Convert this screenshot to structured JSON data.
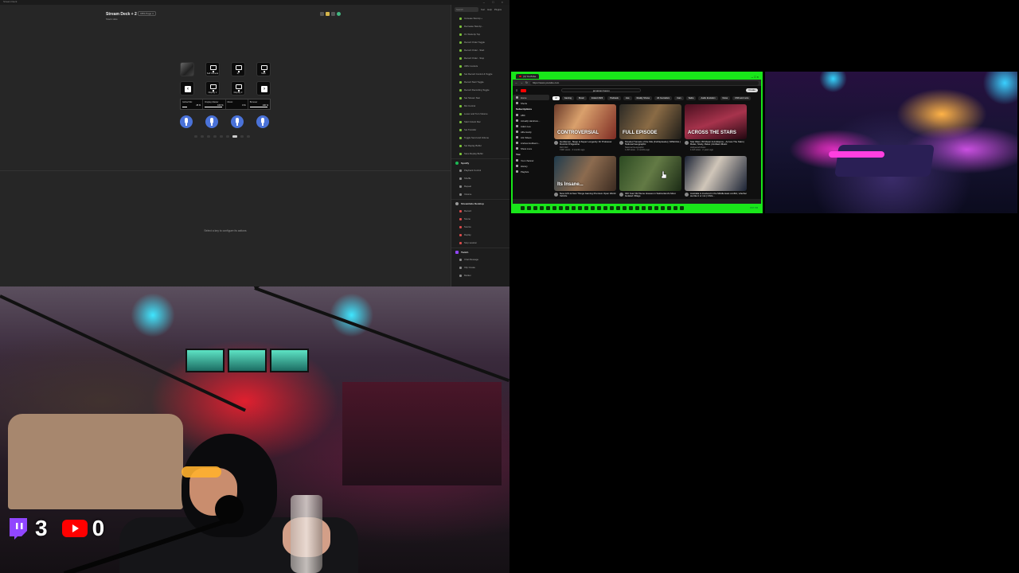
{
  "streamdeck": {
    "app_title": "Stream Deck",
    "window_buttons": "– □ ×",
    "device_name": "Stream Deck + 2",
    "profile_badge": "OBS Page 4",
    "device_sub": "Stack slate",
    "keys": [
      {
        "label": "",
        "kind": "image"
      },
      {
        "label": "Self Camera",
        "kind": "monitor"
      },
      {
        "label": "2x",
        "kind": "monitor"
      },
      {
        "label": "Main",
        "kind": "monitor"
      },
      {
        "label": "",
        "kind": "text",
        "glyph": "‹"
      },
      {
        "label": "Display 2",
        "kind": "monitor"
      },
      {
        "label": "Display 3",
        "kind": "monitor"
      },
      {
        "label": "",
        "kind": "text",
        "glyph": "›"
      }
    ],
    "dials": [
      {
        "label": "Global Mic",
        "value": "25 %",
        "fill": 0.25
      },
      {
        "label": "Display Master",
        "value": "100 %",
        "fill": 1.0
      },
      {
        "label": "Music",
        "value": "0 %",
        "fill": 0.0
      },
      {
        "label": "Browser",
        "value": "100 %",
        "fill": 1.0
      }
    ],
    "pager": {
      "pages": 9,
      "active": 7
    },
    "empty_message": "Select a key to configure its actions",
    "sidebar": {
      "search_placeholder": "Search",
      "tools": [
        "Sort",
        "Help",
        "Plugins"
      ],
      "plugins_a": [
        "Increase Stat Ap +",
        "Decrease Stat Ap -",
        "On Stats Ap Top",
        "Record Order Toggle",
        "Record Order - Start",
        "Record Order - Stop",
        "OBS Controls",
        "Set Record Control & Toggle",
        "Record Start Toggle",
        "Record Recording Toggle",
        "Set Stream Stat",
        "Mic Control",
        "Lower and Turn Volume",
        "Start Instant Rec",
        "Set Transfer",
        "Toggle Send and Volume",
        "Set Replay Buffer",
        "Save Replay Buffer"
      ],
      "group_spotify": "Spotify",
      "plugins_b": [
        "Playback Control",
        "Shuffle",
        "Repeat",
        "Volume"
      ],
      "group_streamlabs": "Streamlabs Desktop",
      "plugins_c": [
        "Record",
        "Scene",
        "Source",
        "Replay",
        "Stop session"
      ],
      "group_twitch": "Twitch",
      "plugins_d": [
        "Chat Message",
        "Clip Create",
        "Marker"
      ]
    }
  },
  "browser": {
    "tab_title": "(4) YouTube",
    "window_buttons": "– □ ×",
    "url": "https://www.youtube.com",
    "search_query": "jamaican bacon",
    "create_label": "Create",
    "sidebar_top": [
      "Home",
      "Shorts"
    ],
    "subscriptions_heading": "Subscriptions",
    "subscriptions": [
      "ABC",
      "Actually Hardcore...",
      "Adam Lee",
      "Alfie Hardy",
      "Ark Videos",
      "Andrew Hubberm...",
      "Show more"
    ],
    "you_heading": "You",
    "you_items": [
      "Your channel",
      "History",
      "Playlists"
    ],
    "chips": [
      "All",
      "Gaming",
      "Music",
      "Ireland 2023",
      "Podcasts",
      "Live",
      "Reality Shows",
      "All Journalism",
      "Cars",
      "Satire",
      "Audio Evolution",
      "News",
      "CNN and more"
    ],
    "videos": [
      {
        "overlay": "CONTROVERSIAL",
        "title": "Gentlemen, Sleep & Super Longevity: Dr Professor Dominic D'Agostino",
        "channel": "Rich Roll",
        "stats": "743K views · 4 months ago"
      },
      {
        "overlay": "FULL EPISODE",
        "title": "Flooded Tunnels of the Nile (Full Episode) | SPECIAL | National Geographic",
        "channel": "National Geographic",
        "stats": "1.2M views · 2 months ago"
      },
      {
        "overlay": "ACROSS THE STARS",
        "title": "Star Wars: 80 Music & Ambience - Across The Stars | Relax, Study, Relax | Ambient Music",
        "channel": "Hollywood Music",
        "stats": "1.1M views · 2 years ago"
      },
      {
        "overlay": "Its Insane...",
        "title": "New GTA & New Things Gaming Premium Open World Vehicle",
        "channel": "",
        "stats": ""
      },
      {
        "overlay": "",
        "title": "300 Year Old Stone Houses in Switzerland's Most Isolated Village",
        "channel": "",
        "stats": ""
      },
      {
        "overlay": "",
        "title": "Australia is involved in the Middle East conflict, whether we like it or not | Chris...",
        "channel": "",
        "stats": ""
      }
    ],
    "taskbar_clock": "8:07 PM"
  },
  "overlay": {
    "twitch_viewers": "3",
    "youtube_viewers": "0"
  },
  "colors": {
    "streamdeck_bg": "#262626",
    "browser_accent": "#19e61a",
    "mic_blue": "#4a72d8",
    "plugin_green": "#7cc33b"
  }
}
